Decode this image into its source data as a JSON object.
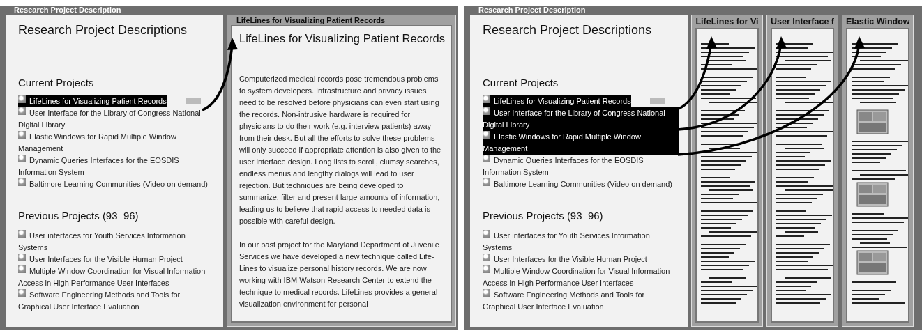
{
  "screens": [
    {
      "title_bar": "Research Project Description",
      "heading": "Research Project Descriptions",
      "current_heading": "Current Projects",
      "current_projects": [
        {
          "label": "LifeLines for Visualizing Patient Records",
          "selected": true
        },
        {
          "label": "User Interface for the Library of Congress National Digital Library",
          "selected": false
        },
        {
          "label": "Elastic Windows for Rapid Multiple Window Management",
          "selected": false
        },
        {
          "label": "Dynamic Queries Interfaces for the EOSDIS Information System",
          "selected": false
        },
        {
          "label": "Baltimore Learning Communities (Video on demand)",
          "selected": false
        }
      ],
      "previous_heading": "Previous Projects (93–96)",
      "previous_projects": [
        {
          "label": "User interfaces for Youth Services Information Systems"
        },
        {
          "label": "User Interfaces for the Visible Human Project"
        },
        {
          "label": "Multiple Window Coordination for Visual Information Access in High Performance User Interfaces"
        },
        {
          "label": "Software Engineering Methods and Tools for Graphical User Interface Evaluation"
        }
      ],
      "detail_panes": [
        {
          "kind": "full",
          "title": "LifeLines for Visualizing Patient Records",
          "heading": "LifeLines for Visualizing Patient Records",
          "paragraphs": [
            "Computerized medical records pose tremendous problems to system developers. Infrastructure and privacy issues need to be resolved before physicians can even start using the records. Non-intrusive hardware is required for physicians to do their work (e.g. interview patients) away from their desk. But all the efforts to solve these problems will only succeed if appropriate attention is also given to the user interface design. Long lists to scroll, clumsy searches, endless menus and lengthy dialogs will lead to user rejection. But techniques are being developed to summarize, filter and present large amounts of information, leading us to believe that rapid access to needed data is possible with careful design.",
            "In our past project for the Maryland Department of Juvenile Services we have developed a new technique called Life-Lines to visualize personal history records. We are now working with IBM Watson Research Center to extend the technique to medical records. LifeLines provides a general visualization environment for personal"
          ]
        }
      ]
    },
    {
      "title_bar": "Research Project Description",
      "heading": "Research Project Descriptions",
      "current_heading": "Current Projects",
      "current_projects": [
        {
          "label": "LifeLines for Visualizing Patient Records",
          "selected": true
        },
        {
          "label": "User Interface for the Library of Congress National Digital Library",
          "selected": true
        },
        {
          "label": "Elastic Windows for Rapid Multiple Window Management",
          "selected": true
        },
        {
          "label": "Dynamic Queries Interfaces for the EOSDIS Information System",
          "selected": false
        },
        {
          "label": "Baltimore Learning Communities (Video on demand)",
          "selected": false
        }
      ],
      "previous_heading": "Previous Projects (93–96)",
      "previous_projects": [
        {
          "label": "User interfaces for Youth Services Information Systems"
        },
        {
          "label": "User Interfaces for the Visible Human Project"
        },
        {
          "label": "Multiple Window Coordination for Visual Information Access in High Performance User Interfaces"
        },
        {
          "label": "Software Engineering Methods and Tools for Graphical User Interface Evaluation"
        }
      ],
      "detail_panes": [
        {
          "kind": "greeked",
          "title": "LifeLines for Vi"
        },
        {
          "kind": "greeked",
          "title": "User Interface f"
        },
        {
          "kind": "greeked",
          "title": "Elastic Window",
          "thumbnails": true
        }
      ]
    }
  ]
}
